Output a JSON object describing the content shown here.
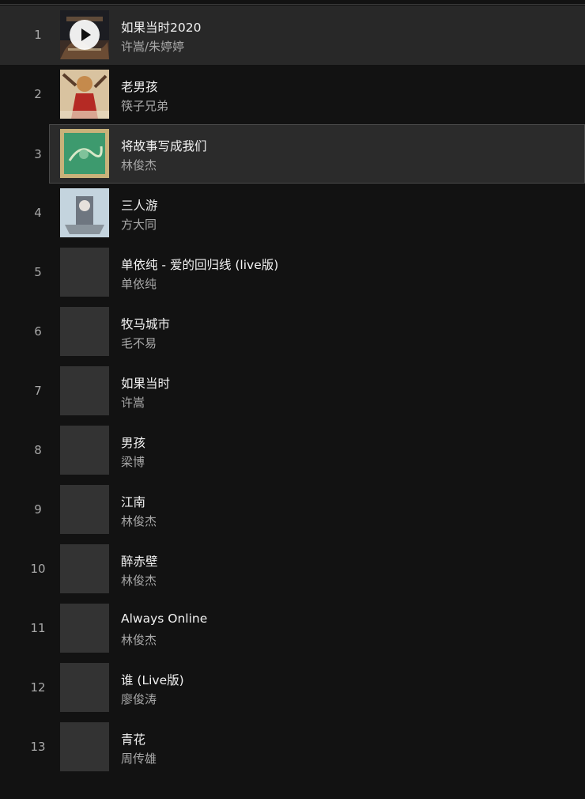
{
  "tracks": [
    {
      "index": "1",
      "title": "如果当时2020",
      "artist": "许嵩/朱婷婷",
      "cover": "art-1",
      "state": "playing"
    },
    {
      "index": "2",
      "title": "老男孩",
      "artist": "筷子兄弟",
      "cover": "art-2",
      "state": ""
    },
    {
      "index": "3",
      "title": "将故事写成我们",
      "artist": "林俊杰",
      "cover": "art-3",
      "state": "selected"
    },
    {
      "index": "4",
      "title": "三人游",
      "artist": "方大同",
      "cover": "art-4",
      "state": ""
    },
    {
      "index": "5",
      "title": "单依纯 - 爱的回归线 (live版)",
      "artist": "单依纯",
      "cover": "blank",
      "state": ""
    },
    {
      "index": "6",
      "title": "牧马城市",
      "artist": "毛不易",
      "cover": "blank",
      "state": ""
    },
    {
      "index": "7",
      "title": "如果当时",
      "artist": "许嵩",
      "cover": "blank",
      "state": ""
    },
    {
      "index": "8",
      "title": "男孩",
      "artist": "梁博",
      "cover": "blank",
      "state": ""
    },
    {
      "index": "9",
      "title": "江南",
      "artist": "林俊杰",
      "cover": "blank",
      "state": ""
    },
    {
      "index": "10",
      "title": "醉赤壁",
      "artist": "林俊杰",
      "cover": "blank",
      "state": ""
    },
    {
      "index": "11",
      "title": "Always Online",
      "artist": "林俊杰",
      "cover": "blank",
      "state": ""
    },
    {
      "index": "12",
      "title": "谁 (Live版)",
      "artist": "廖俊涛",
      "cover": "blank",
      "state": ""
    },
    {
      "index": "13",
      "title": "青花",
      "artist": "周传雄",
      "cover": "blank",
      "state": ""
    }
  ]
}
